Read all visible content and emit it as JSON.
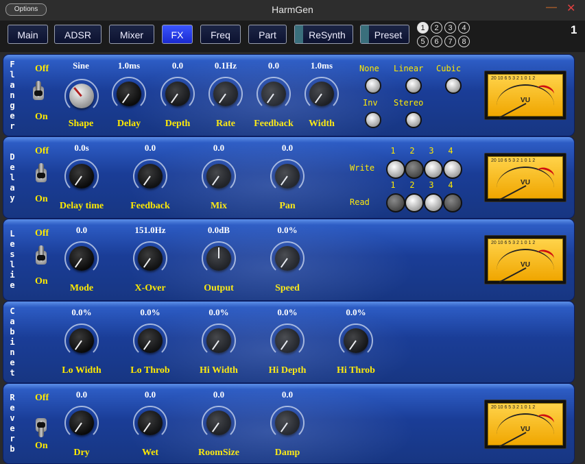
{
  "window": {
    "options_label": "Options",
    "title": "HarmGen",
    "minimize_glyph": "—",
    "close_glyph": "✕"
  },
  "nav": {
    "tabs": [
      {
        "label": "Main"
      },
      {
        "label": "ADSR"
      },
      {
        "label": "Mixer"
      },
      {
        "label": "FX",
        "active": true
      },
      {
        "label": "Freq"
      },
      {
        "label": "Part"
      },
      {
        "label": "ReSynth"
      },
      {
        "label": "Preset"
      }
    ],
    "slots": [
      "1",
      "2",
      "3",
      "4",
      "5",
      "6",
      "7",
      "8"
    ],
    "selected_slot": "1",
    "page_number": "1"
  },
  "switch_labels": {
    "off": "Off",
    "on": "On"
  },
  "flanger": {
    "title": "Flanger",
    "knobs": [
      {
        "label": "Shape",
        "value": "Sine"
      },
      {
        "label": "Delay",
        "value": "1.0ms"
      },
      {
        "label": "Depth",
        "value": "0.0"
      },
      {
        "label": "Rate",
        "value": "0.1Hz"
      },
      {
        "label": "Feedback",
        "value": "0.0"
      },
      {
        "label": "Width",
        "value": "1.0ms"
      }
    ],
    "interp_options": [
      "None",
      "Linear",
      "Cubic"
    ],
    "mode_options": [
      "Inv",
      "Stereo"
    ],
    "vu_label": "VU"
  },
  "delay": {
    "title": "Delay",
    "knobs": [
      {
        "label": "Delay time",
        "value": "0.0s"
      },
      {
        "label": "Feedback",
        "value": "0.0"
      },
      {
        "label": "Mix",
        "value": "0.0"
      },
      {
        "label": "Pan",
        "value": "0.0"
      }
    ],
    "write_label": "Write",
    "read_label": "Read",
    "tap_numbers": [
      "1",
      "2",
      "3",
      "4"
    ],
    "vu_label": "VU"
  },
  "leslie": {
    "title": "Leslie",
    "knobs": [
      {
        "label": "Mode",
        "value": "0.0"
      },
      {
        "label": "X-Over",
        "value": "151.0Hz"
      },
      {
        "label": "Output",
        "value": "0.0dB"
      },
      {
        "label": "Speed",
        "value": "0.0%"
      }
    ],
    "vu_label": "VU"
  },
  "cabinet": {
    "title": "Cabinet",
    "knobs": [
      {
        "label": "Lo Width",
        "value": "0.0%"
      },
      {
        "label": "Lo Throb",
        "value": "0.0%"
      },
      {
        "label": "Hi Width",
        "value": "0.0%"
      },
      {
        "label": "Hi Depth",
        "value": "0.0%"
      },
      {
        "label": "Hi Throb",
        "value": "0.0%"
      }
    ]
  },
  "reverb": {
    "title": "Reverb",
    "knobs": [
      {
        "label": "Dry",
        "value": "0.0"
      },
      {
        "label": "Wet",
        "value": "0.0"
      },
      {
        "label": "RoomSize",
        "value": "0.0"
      },
      {
        "label": "Damp",
        "value": "0.0"
      }
    ],
    "vu_label": "VU"
  },
  "vu_scale": "20 10 6 5 3 2 1 0 1 2"
}
